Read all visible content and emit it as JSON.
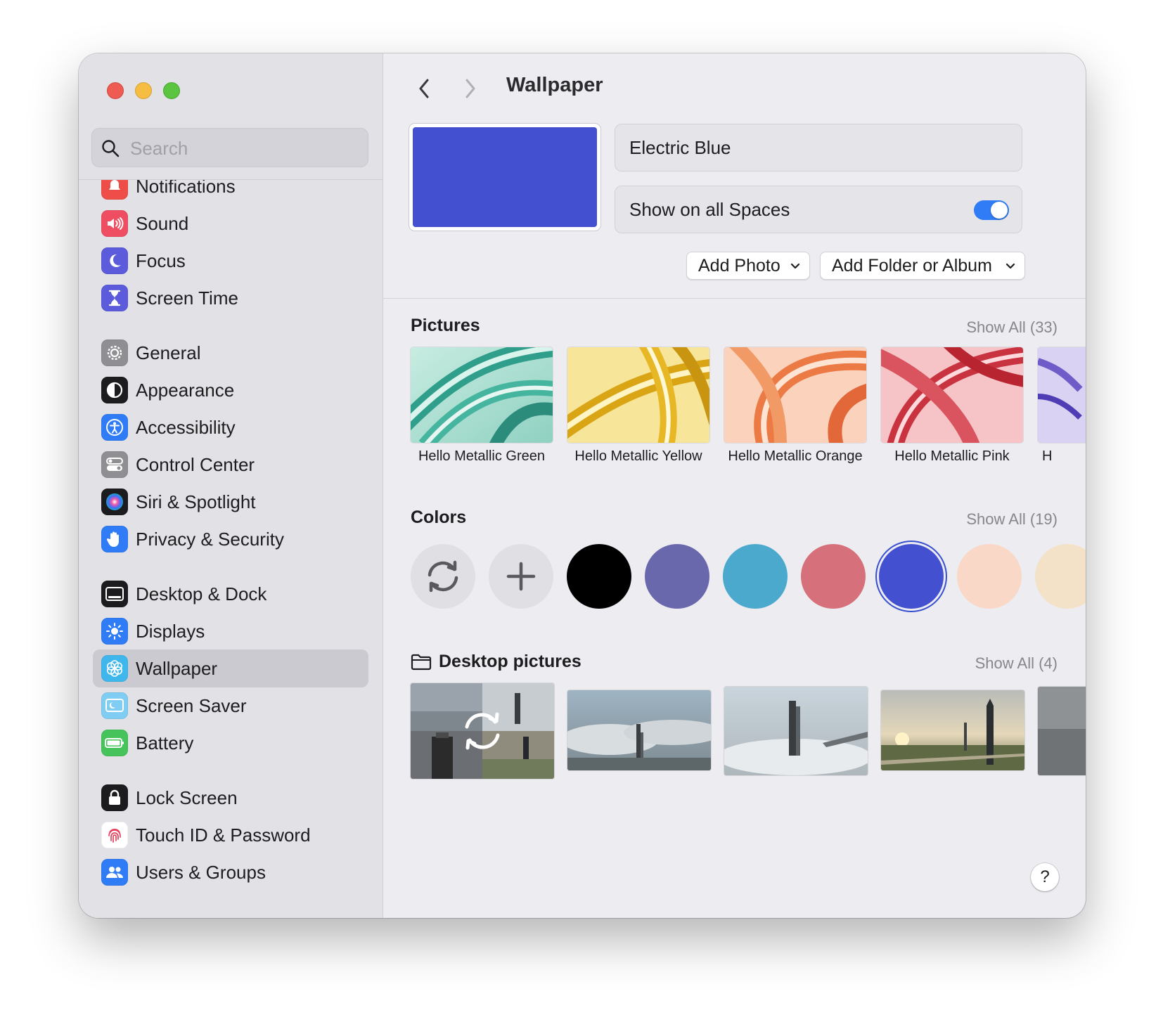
{
  "search": {
    "placeholder": "Search"
  },
  "sidebar": {
    "items": [
      {
        "label": "Notifications",
        "icon": "bell-icon"
      },
      {
        "label": "Sound",
        "icon": "speaker-icon"
      },
      {
        "label": "Focus",
        "icon": "moon-icon"
      },
      {
        "label": "Screen Time",
        "icon": "hourglass-icon"
      },
      {
        "label": "General",
        "icon": "gear-icon"
      },
      {
        "label": "Appearance",
        "icon": "appearance-icon"
      },
      {
        "label": "Accessibility",
        "icon": "accessibility-icon"
      },
      {
        "label": "Control Center",
        "icon": "toggles-icon"
      },
      {
        "label": "Siri & Spotlight",
        "icon": "siri-icon"
      },
      {
        "label": "Privacy & Security",
        "icon": "hand-icon"
      },
      {
        "label": "Desktop & Dock",
        "icon": "dock-icon"
      },
      {
        "label": "Displays",
        "icon": "sun-icon"
      },
      {
        "label": "Wallpaper",
        "icon": "flower-icon"
      },
      {
        "label": "Screen Saver",
        "icon": "screensaver-icon"
      },
      {
        "label": "Battery",
        "icon": "battery-icon"
      },
      {
        "label": "Lock Screen",
        "icon": "lock-icon"
      },
      {
        "label": "Touch ID & Password",
        "icon": "fingerprint-icon"
      },
      {
        "label": "Users & Groups",
        "icon": "users-icon"
      }
    ],
    "selected": "Wallpaper"
  },
  "header": {
    "title": "Wallpaper"
  },
  "current": {
    "name": "Electric Blue",
    "color": "#4351d1",
    "show_on_all_spaces_label": "Show on all Spaces",
    "show_on_all_spaces": true
  },
  "buttons": {
    "add_photo": "Add Photo",
    "add_folder": "Add Folder or Album"
  },
  "pictures": {
    "title": "Pictures",
    "show_all": "Show All (33)",
    "items": [
      {
        "label": "Hello Metallic Green"
      },
      {
        "label": "Hello Metallic Yellow"
      },
      {
        "label": "Hello Metallic Orange"
      },
      {
        "label": "Hello Metallic Pink"
      },
      {
        "label": "H"
      }
    ]
  },
  "colors": {
    "title": "Colors",
    "show_all": "Show All (19)",
    "swatches": [
      "#000000",
      "#6a68ad",
      "#4aa9cc",
      "#d6707a",
      "#4351d1",
      "#f9d8c7",
      "#f3e2c8"
    ],
    "selected_index": 4
  },
  "desktop_pictures": {
    "title": "Desktop pictures",
    "show_all": "Show All (4)"
  },
  "theme": {
    "accent": "#2f7cf6"
  },
  "help_label": "?"
}
